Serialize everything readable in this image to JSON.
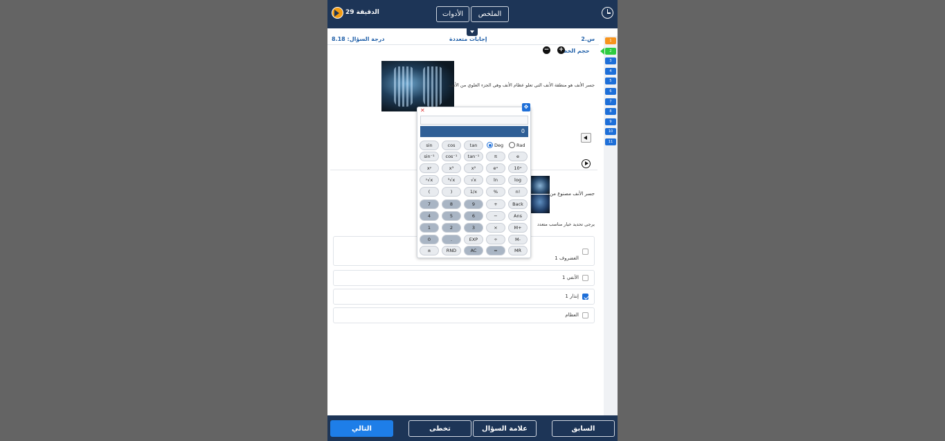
{
  "topbar": {
    "timer_text": "29 الدقيقة",
    "summary_label": "الملخص",
    "tools_label": "الأدوات"
  },
  "question": {
    "number": "س.2",
    "type": "إجابات متعددة",
    "score": "درجة السؤال: 8.18",
    "font_size_label": "حجم الخط",
    "description": "جسر الأنف هو منطقة الأنف التي تعلو عظام الأنف وهي الجزء العلوي من الأنف.",
    "prompt": "جسر الأنف مصنوع من؟",
    "instruction": "يرجى تحديد خيار مناسب متعدد"
  },
  "options": [
    {
      "label": "الغضروف 1",
      "checked": false
    },
    {
      "label": "الأنفي 1",
      "checked": false
    },
    {
      "label": "إنذار 1",
      "checked": true
    },
    {
      "label": "العظام",
      "checked": false
    }
  ],
  "sidenav": {
    "items": [
      "1",
      "2",
      "3",
      "4",
      "5",
      "6",
      "7",
      "8",
      "9",
      "10",
      "11"
    ],
    "flagged": "1",
    "current": "2"
  },
  "calculator": {
    "display": "0",
    "expression": "",
    "angle_modes": [
      "Deg",
      "Rad"
    ],
    "selected_mode": "Deg",
    "rows": [
      [
        "sin",
        "cos",
        "tan"
      ],
      [
        "sin⁻¹",
        "cos⁻¹",
        "tan⁻¹",
        "π",
        "e"
      ],
      [
        "xʸ",
        "x³",
        "x²",
        "eˣ",
        "10ˣ"
      ],
      [
        "ʸ√x",
        "³√x",
        "√x",
        "ln",
        "log"
      ],
      [
        "(",
        ")",
        "1/x",
        "%",
        "n!"
      ],
      [
        "7",
        "8",
        "9",
        "+",
        "Back"
      ],
      [
        "4",
        "5",
        "6",
        "−",
        "Ans"
      ],
      [
        "1",
        "2",
        "3",
        "×",
        "M+"
      ],
      [
        "0",
        ".",
        "EXP",
        "÷",
        "M-"
      ],
      [
        "±",
        "RND",
        "AC",
        "=",
        "MR"
      ]
    ]
  },
  "bottombar": {
    "previous_label": "السابق",
    "mark_label": "علامة السؤال",
    "skip_label": "تخطى",
    "next_label": "التالي"
  },
  "colors": {
    "navy": "#1d3557",
    "accent_blue": "#1e6fd8",
    "flag_orange": "#f7941d",
    "current_green": "#2ecc40"
  }
}
